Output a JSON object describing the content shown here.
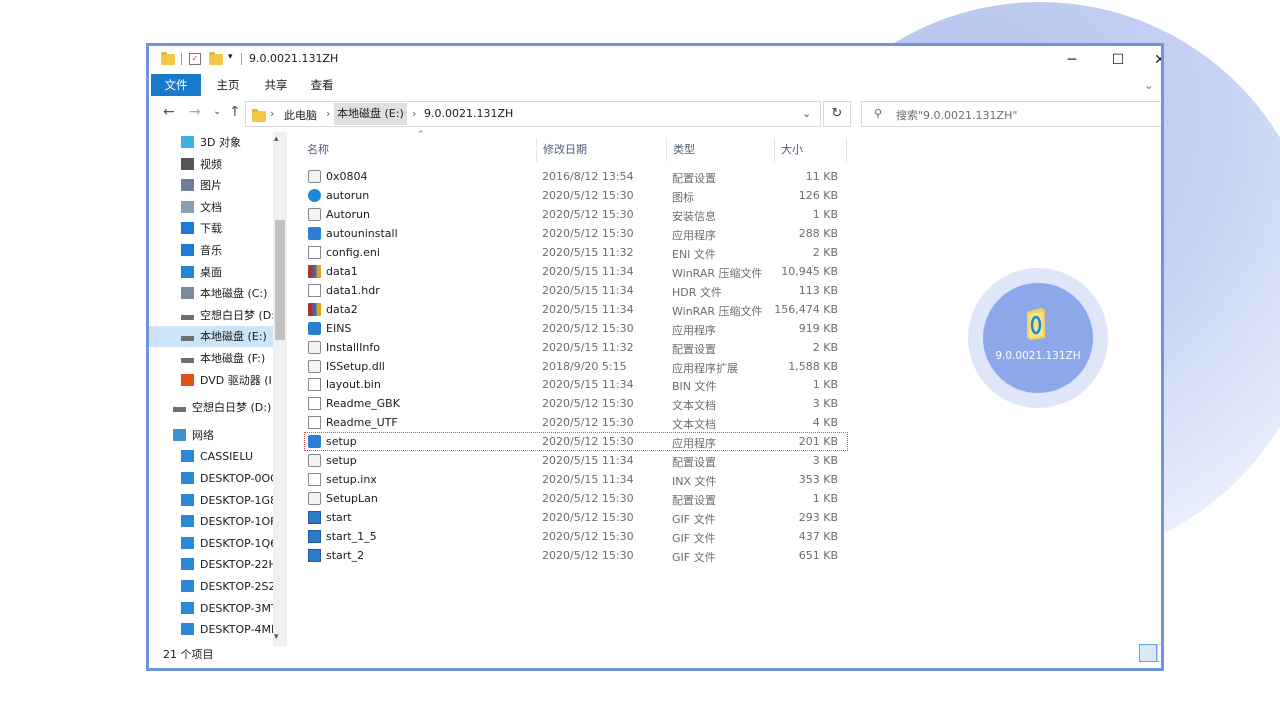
{
  "window": {
    "title": "9.0.0021.131ZH",
    "controls": {
      "minimize": "─",
      "maximize": "☐",
      "close": "✕"
    }
  },
  "ribbon": {
    "tabs": [
      "文件",
      "主页",
      "共享",
      "查看"
    ],
    "expand": "⌄"
  },
  "address": {
    "back": "←",
    "forward": "→",
    "recent": "⌄",
    "up": "↑",
    "crumbs": [
      "此电脑",
      "本地磁盘 (E:)",
      "9.0.0021.131ZH"
    ],
    "dropdown": "⌄",
    "refresh": "↻"
  },
  "search": {
    "placeholder": "搜索\"9.0.0021.131ZH\""
  },
  "nav": {
    "items": [
      {
        "label": "3D 对象",
        "icon": "3d-objects-icon",
        "indent": 2
      },
      {
        "label": "视频",
        "icon": "video-icon",
        "indent": 2
      },
      {
        "label": "图片",
        "icon": "pictures-icon",
        "indent": 2
      },
      {
        "label": "文档",
        "icon": "documents-icon",
        "indent": 2
      },
      {
        "label": "下载",
        "icon": "download-icon",
        "indent": 2
      },
      {
        "label": "音乐",
        "icon": "music-icon",
        "indent": 2
      },
      {
        "label": "桌面",
        "icon": "desktop-icon",
        "indent": 2
      },
      {
        "label": "本地磁盘 (C:)",
        "icon": "windows-drive-icon",
        "indent": 2
      },
      {
        "label": "空想白日梦 (D:",
        "icon": "drive-icon",
        "indent": 2
      },
      {
        "label": "本地磁盘 (E:)",
        "icon": "drive-icon",
        "indent": 2,
        "selected": true
      },
      {
        "label": "本地磁盘 (F:)",
        "icon": "drive-icon",
        "indent": 2
      },
      {
        "label": "DVD 驱动器 (I:",
        "icon": "dvd-drive-icon",
        "indent": 2
      },
      {
        "label": "空想白日梦 (D:)",
        "icon": "drive-icon",
        "indent": 1
      },
      {
        "label": "网络",
        "icon": "network-icon",
        "indent": 1
      },
      {
        "label": "CASSIELU",
        "icon": "computer-icon",
        "indent": 2
      },
      {
        "label": "DESKTOP-0OC",
        "icon": "computer-icon",
        "indent": 2
      },
      {
        "label": "DESKTOP-1G8",
        "icon": "computer-icon",
        "indent": 2
      },
      {
        "label": "DESKTOP-1OF",
        "icon": "computer-icon",
        "indent": 2
      },
      {
        "label": "DESKTOP-1Q6",
        "icon": "computer-icon",
        "indent": 2
      },
      {
        "label": "DESKTOP-22H",
        "icon": "computer-icon",
        "indent": 2
      },
      {
        "label": "DESKTOP-2S2",
        "icon": "computer-icon",
        "indent": 2
      },
      {
        "label": "DESKTOP-3MT",
        "icon": "computer-icon",
        "indent": 2
      },
      {
        "label": "DESKTOP-4MI",
        "icon": "computer-icon",
        "indent": 2
      }
    ]
  },
  "columns": {
    "name": "名称",
    "date": "修改日期",
    "type": "类型",
    "size": "大小"
  },
  "files": [
    {
      "name": "0x0804",
      "date": "2016/8/12 13:54",
      "type": "配置设置",
      "size": "11 KB",
      "icon": "cfg"
    },
    {
      "name": "autorun",
      "date": "2020/5/12 15:30",
      "type": "图标",
      "size": "126 KB",
      "icon": "blue"
    },
    {
      "name": "Autorun",
      "date": "2020/5/12 15:30",
      "type": "安装信息",
      "size": "1 KB",
      "icon": "cfg"
    },
    {
      "name": "autouninstall",
      "date": "2020/5/12 15:30",
      "type": "应用程序",
      "size": "288 KB",
      "icon": "exe"
    },
    {
      "name": "config.eni",
      "date": "2020/5/15 11:32",
      "type": "ENI 文件",
      "size": "2 KB",
      "icon": "txt"
    },
    {
      "name": "data1",
      "date": "2020/5/15 11:34",
      "type": "WinRAR 压缩文件",
      "size": "10,945 KB",
      "icon": "rar"
    },
    {
      "name": "data1.hdr",
      "date": "2020/5/15 11:34",
      "type": "HDR 文件",
      "size": "113 KB",
      "icon": "txt"
    },
    {
      "name": "data2",
      "date": "2020/5/15 11:34",
      "type": "WinRAR 压缩文件",
      "size": "156,474 KB",
      "icon": "rar"
    },
    {
      "name": "EINS",
      "date": "2020/5/12 15:30",
      "type": "应用程序",
      "size": "919 KB",
      "icon": "exe"
    },
    {
      "name": "InstallInfo",
      "date": "2020/5/15 11:32",
      "type": "配置设置",
      "size": "2 KB",
      "icon": "cfg"
    },
    {
      "name": "ISSetup.dll",
      "date": "2018/9/20 5:15",
      "type": "应用程序扩展",
      "size": "1,588 KB",
      "icon": "cfg"
    },
    {
      "name": "layout.bin",
      "date": "2020/5/15 11:34",
      "type": "BIN 文件",
      "size": "1 KB",
      "icon": "txt"
    },
    {
      "name": "Readme_GBK",
      "date": "2020/5/12 15:30",
      "type": "文本文档",
      "size": "3 KB",
      "icon": "txt"
    },
    {
      "name": "Readme_UTF",
      "date": "2020/5/12 15:30",
      "type": "文本文档",
      "size": "4 KB",
      "icon": "txt"
    },
    {
      "name": "setup",
      "date": "2020/5/12 15:30",
      "type": "应用程序",
      "size": "201 KB",
      "icon": "exe",
      "focused": true
    },
    {
      "name": "setup",
      "date": "2020/5/15 11:34",
      "type": "配置设置",
      "size": "3 KB",
      "icon": "cfg"
    },
    {
      "name": "setup.inx",
      "date": "2020/5/15 11:34",
      "type": "INX 文件",
      "size": "353 KB",
      "icon": "txt"
    },
    {
      "name": "SetupLan",
      "date": "2020/5/12 15:30",
      "type": "配置设置",
      "size": "1 KB",
      "icon": "cfg"
    },
    {
      "name": "start",
      "date": "2020/5/12 15:30",
      "type": "GIF 文件",
      "size": "293 KB",
      "icon": "gif"
    },
    {
      "name": "start_1_5",
      "date": "2020/5/12 15:30",
      "type": "GIF 文件",
      "size": "437 KB",
      "icon": "gif"
    },
    {
      "name": "start_2",
      "date": "2020/5/12 15:30",
      "type": "GIF 文件",
      "size": "651 KB",
      "icon": "gif"
    }
  ],
  "status": {
    "count": "21 个项目"
  },
  "floating": {
    "label": "9.0.0021.131ZH"
  },
  "colors": {
    "accent": "#1979ca",
    "window_border": "#6e95dd",
    "selection": "#cce4f7"
  }
}
